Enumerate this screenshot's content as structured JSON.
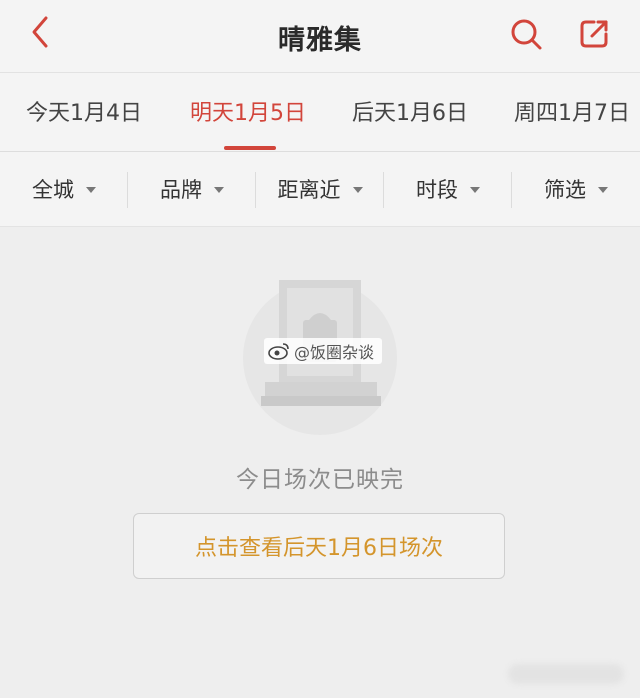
{
  "header": {
    "title": "晴雅集",
    "back_icon": "chevron-left-icon",
    "search_icon": "search-icon",
    "share_icon": "share-icon",
    "accent_color": "#d2453b"
  },
  "date_tabs": [
    {
      "label": "今天1月4日",
      "active": false
    },
    {
      "label": "明天1月5日",
      "active": true
    },
    {
      "label": "后天1月6日",
      "active": false
    },
    {
      "label": "周四1月7日",
      "active": false
    }
  ],
  "filters": [
    {
      "label": "全城"
    },
    {
      "label": "品牌"
    },
    {
      "label": "距离近"
    },
    {
      "label": "时段"
    },
    {
      "label": "筛选"
    }
  ],
  "empty_state": {
    "message": "今日场次已映完",
    "action_label": "点击查看后天1月6日场次",
    "action_color": "#d4952c"
  },
  "watermark": {
    "text": "@饭圈杂谈",
    "icon": "weibo-icon"
  }
}
